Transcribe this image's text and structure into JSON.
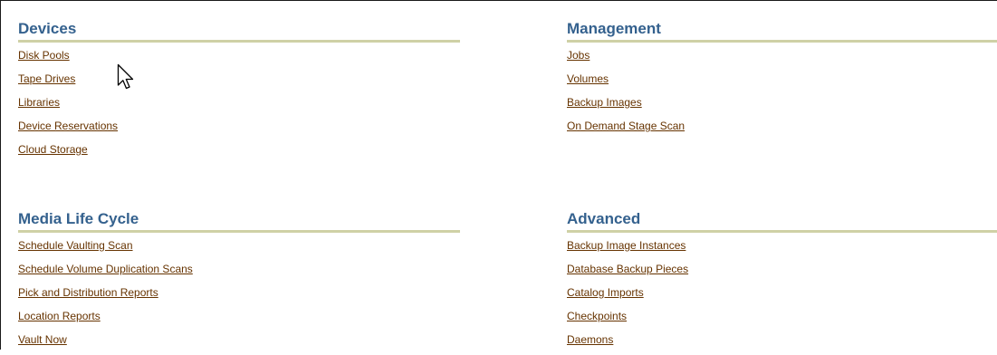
{
  "sections": {
    "devices": {
      "title": "Devices",
      "links": [
        "Disk Pools",
        "Tape Drives",
        "Libraries",
        "Device Reservations",
        "Cloud Storage"
      ]
    },
    "management": {
      "title": "Management",
      "links": [
        "Jobs",
        "Volumes",
        "Backup Images",
        "On Demand Stage Scan"
      ]
    },
    "media_life_cycle": {
      "title": "Media Life Cycle",
      "links": [
        "Schedule Vaulting Scan",
        "Schedule Volume Duplication Scans",
        "Pick and Distribution Reports",
        "Location Reports",
        "Vault Now"
      ]
    },
    "advanced": {
      "title": "Advanced",
      "links": [
        "Backup Image Instances",
        "Database Backup Pieces",
        "Catalog Imports",
        "Checkpoints",
        "Daemons"
      ]
    }
  },
  "colors": {
    "heading": "#34618e",
    "rule": "#cfd1a6",
    "link": "#663300"
  },
  "icons": {
    "pointer": "mouse-pointer-icon"
  }
}
